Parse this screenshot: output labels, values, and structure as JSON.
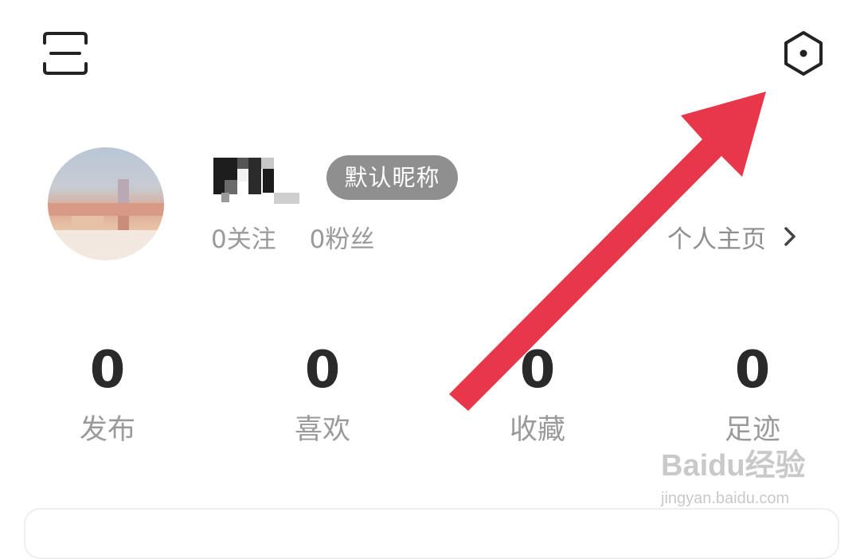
{
  "header": {
    "menu_icon": "scan-menu-icon",
    "settings_icon": "hexagon-settings-icon"
  },
  "profile": {
    "avatar": "blurred-avatar",
    "nickname_badge": "默认昵称",
    "following": "0关注",
    "followers": "0粉丝",
    "homepage_link": "个人主页",
    "homepage_icon": "chevron-right-icon"
  },
  "stats": [
    {
      "value": "0",
      "label": "发布"
    },
    {
      "value": "0",
      "label": "喜欢"
    },
    {
      "value": "0",
      "label": "收藏"
    },
    {
      "value": "0",
      "label": "足迹"
    }
  ],
  "annotation": {
    "arrow_color": "#e8364a",
    "arrow_icon": "red-arrow-icon"
  },
  "watermark": {
    "brand": "Baidu经验",
    "site": "jingyan.baidu.com"
  }
}
